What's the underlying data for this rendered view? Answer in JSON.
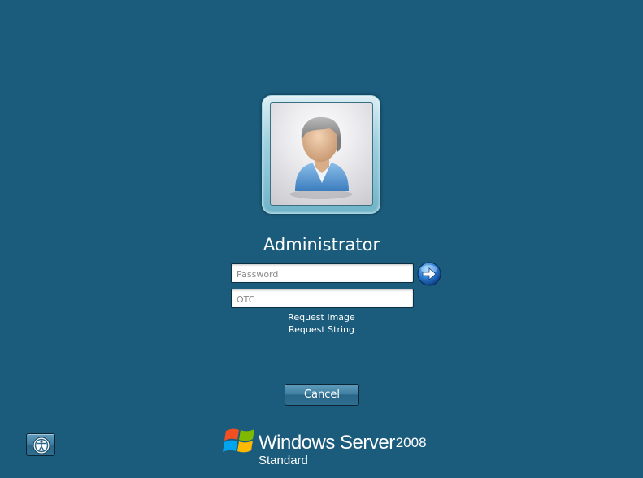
{
  "user": {
    "name": "Administrator",
    "avatar_icon": "user-avatar-icon"
  },
  "fields": {
    "password": {
      "placeholder": "Password",
      "value": ""
    },
    "otc": {
      "placeholder": "OTC",
      "value": ""
    }
  },
  "submit": {
    "icon": "arrow-right-icon"
  },
  "links": {
    "request_image": "Request Image",
    "request_string": "Request String"
  },
  "buttons": {
    "cancel": "Cancel",
    "ease_of_access_icon": "ease-of-access-icon"
  },
  "branding": {
    "product": "Windows Server",
    "year": "2008",
    "edition": "Standard",
    "logo_icon": "windows-flag-icon"
  },
  "colors": {
    "background": "#1b5c7c",
    "text": "#ffffff",
    "button_accent": "#3f7ea1",
    "flag_red": "#f25022",
    "flag_green": "#7fba00",
    "flag_blue": "#00a4ef",
    "flag_yellow": "#ffb900"
  }
}
